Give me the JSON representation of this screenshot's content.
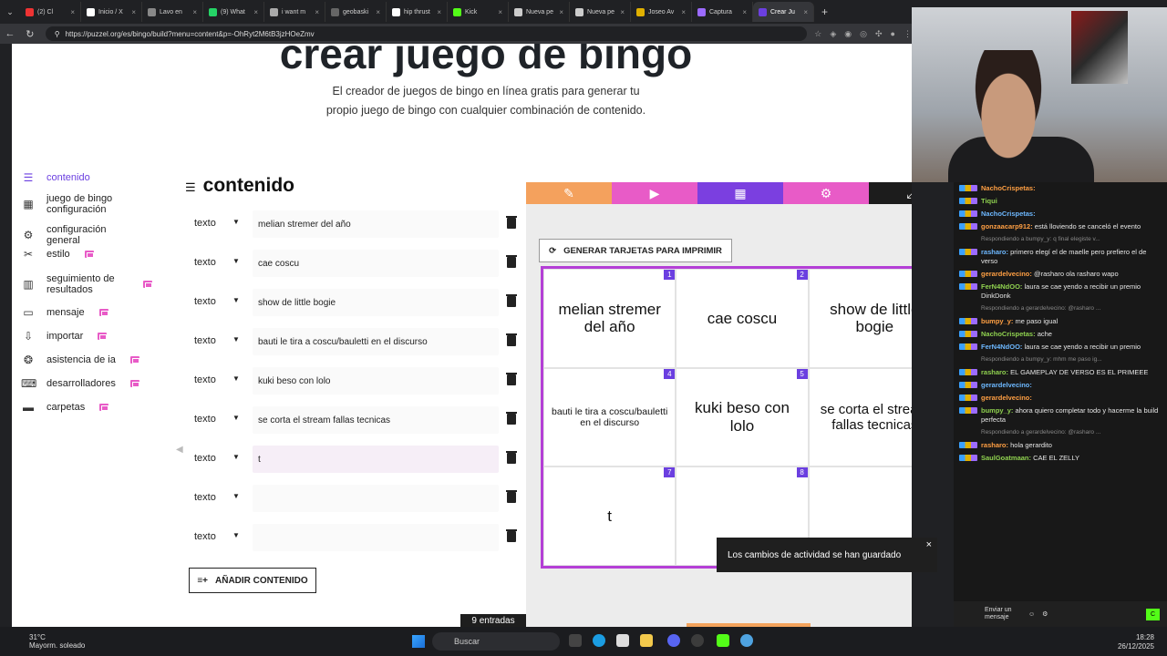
{
  "browser": {
    "tabs": [
      {
        "label": "(2) Cl",
        "color": "#e33"
      },
      {
        "label": "Inicio / X",
        "color": "#fff"
      },
      {
        "label": "Lavo en",
        "color": "#888"
      },
      {
        "label": "(9) What",
        "color": "#25d366"
      },
      {
        "label": "i want m",
        "color": "#aaa"
      },
      {
        "label": "geobaski",
        "color": "#666"
      },
      {
        "label": "hip thrust",
        "color": "#fff"
      },
      {
        "label": "Kick",
        "color": "#53fc18"
      },
      {
        "label": "Nueva pe",
        "color": "#ccc"
      },
      {
        "label": "Nueva pe",
        "color": "#ccc"
      },
      {
        "label": "Joseo Av",
        "color": "#e0b000"
      },
      {
        "label": "Captura",
        "color": "#9c6bff"
      },
      {
        "label": "Crear Ju",
        "color": "#6b3fe0"
      }
    ],
    "url": "https://puzzel.org/es/bingo/build?menu=content&p=-OhRyt2M6tB3jzHOeZmv"
  },
  "hero": {
    "title": "crear juego de bingo",
    "description": "El creador de juegos de bingo en línea gratis para generar tu propio juego de bingo con cualquier combinación de contenido."
  },
  "sidebar": {
    "items": [
      {
        "label": "contenido",
        "icon": "list-icon",
        "pro": false
      },
      {
        "label": "juego de bingo configuración",
        "icon": "grid-icon",
        "pro": false
      },
      {
        "label": "configuración general",
        "icon": "gear-icon",
        "pro": false
      },
      {
        "label": "estilo",
        "icon": "brush-icon",
        "pro": true
      },
      {
        "label": "seguimiento de resultados",
        "icon": "bar-chart-icon",
        "pro": true
      },
      {
        "label": "mensaje",
        "icon": "message-icon",
        "pro": true
      },
      {
        "label": "importar",
        "icon": "import-icon",
        "pro": true
      },
      {
        "label": "asistencia de ia",
        "icon": "brain-icon",
        "pro": true
      },
      {
        "label": "desarrolladores",
        "icon": "code-icon",
        "pro": true
      },
      {
        "label": "carpetas",
        "icon": "folder-icon",
        "pro": true
      }
    ]
  },
  "content": {
    "heading": "contenido",
    "type_label": "texto",
    "entries": [
      "melian stremer del año",
      "cae coscu",
      "show de little bogie",
      "bauti le tira a coscu/bauletti en el discurso",
      "kuki beso con lolo",
      "se corta el stream fallas tecnicas",
      "t",
      "",
      ""
    ],
    "add_button": "AÑADIR CONTENIDO",
    "entry_count": "9 entradas"
  },
  "preview": {
    "generate_button": "GENERAR TARJETAS PARA IMPRIMIR",
    "tab_colors": [
      "#f4a15d",
      "#e85bc7",
      "#7b3fe0",
      "#e85bc7",
      "#1c1c1c"
    ],
    "cells": [
      {
        "num": "1",
        "text": "melian stremer del año",
        "size": 17
      },
      {
        "num": "2",
        "text": "cae coscu",
        "size": 17
      },
      {
        "num": "3",
        "text": "show de little bogie",
        "size": 17
      },
      {
        "num": "4",
        "text": "bauti le tira a coscu/bauletti en el discurso",
        "size": 10.5
      },
      {
        "num": "5",
        "text": "kuki beso con lolo",
        "size": 17
      },
      {
        "num": "6",
        "text": "se corta el stream fallas tecnicas",
        "size": 15
      },
      {
        "num": "7",
        "text": "t",
        "size": 17
      },
      {
        "num": "8",
        "text": "",
        "size": 17
      },
      {
        "num": "9",
        "text": "",
        "size": 17
      }
    ]
  },
  "toast": {
    "text": "Los cambios de actividad se han guardado"
  },
  "chat": {
    "messages": [
      {
        "user": "NachoCrispetas:",
        "text": "",
        "reply": false
      },
      {
        "user": "Tiqui",
        "text": "",
        "reply": false
      },
      {
        "user": "NachoCrispetas:",
        "text": "",
        "reply": false
      },
      {
        "user": "gonzaacarp912:",
        "text": "está lloviendo se canceló el evento",
        "reply": false
      },
      {
        "user": "",
        "text": "Respondiendo a bumpy_y: q final elegiste v...",
        "reply": true
      },
      {
        "user": "rasharo:",
        "text": "primero elegí el de maelle pero prefiero el de verso",
        "reply": false
      },
      {
        "user": "gerardelvecino:",
        "text": "@rasharo ola rasharo wapo",
        "reply": false
      },
      {
        "user": "FerN4NdOO:",
        "text": "laura se cae yendo a recibir un premio DinkDonk",
        "reply": false
      },
      {
        "user": "",
        "text": "Respondiendo a gerardelvecino: @rasharo ...",
        "reply": true
      },
      {
        "user": "bumpy_y:",
        "text": "me paso igual",
        "reply": false
      },
      {
        "user": "NachoCrispetas:",
        "text": "ache",
        "reply": false
      },
      {
        "user": "FerN4NdOO:",
        "text": "laura se cae yendo a recibir un premio",
        "reply": false
      },
      {
        "user": "",
        "text": "Respondiendo a bumpy_y: mhm me paso ig...",
        "reply": true
      },
      {
        "user": "rasharo:",
        "text": "EL GAMEPLAY DE VERSO ES EL PRIMEEE",
        "reply": false
      },
      {
        "user": "gerardelvecino:",
        "text": "",
        "reply": false
      },
      {
        "user": "gerardelvecino:",
        "text": "",
        "reply": false
      },
      {
        "user": "bumpy_y:",
        "text": "ahora quiero completar todo y hacerme la build perfecta",
        "reply": false
      },
      {
        "user": "",
        "text": "Respondiendo a gerardelvecino: @rasharo ...",
        "reply": true
      },
      {
        "user": "rasharo:",
        "text": "hola gerardito",
        "reply": false
      },
      {
        "user": "SaulGoatmaan:",
        "text": "CAE EL ZELLY",
        "reply": false
      }
    ],
    "send_label": "Enviar un mensaje"
  },
  "taskbar": {
    "weather_temp": "31°C",
    "weather_desc": "Mayorm. soleado",
    "search": "Buscar",
    "time": "18:28",
    "date": "26/12/2025"
  }
}
